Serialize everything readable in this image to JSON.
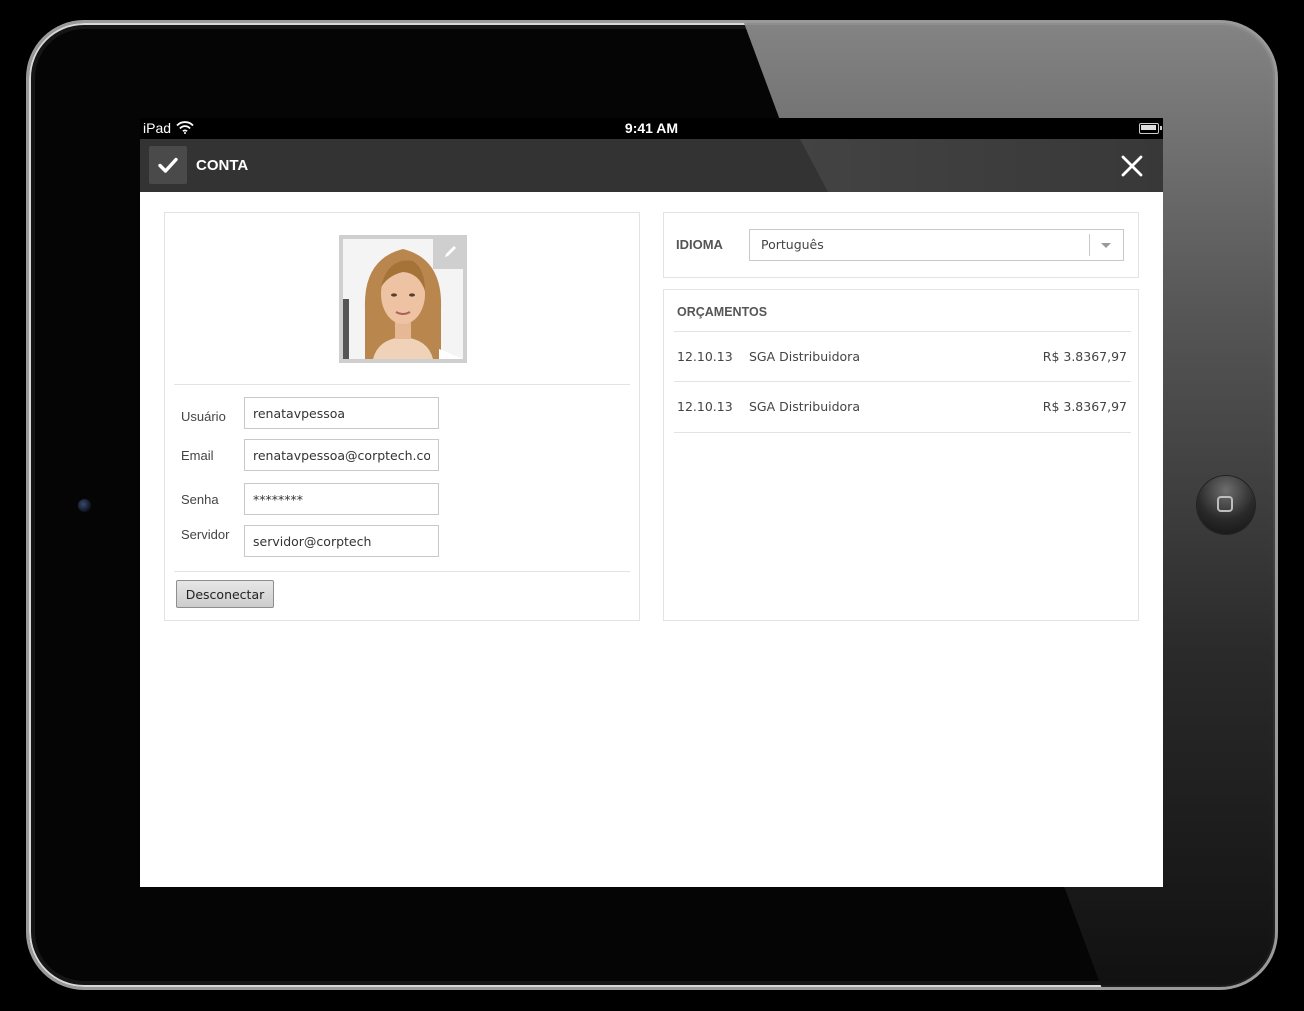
{
  "statusbar": {
    "carrier": "iPad",
    "time": "9:41 AM"
  },
  "navbar": {
    "title": "CONTA"
  },
  "profile": {
    "fields": [
      {
        "label": "Usuário",
        "value": "renatavpessoa"
      },
      {
        "label": "Email",
        "value": "renatavpessoa@corptech.com"
      },
      {
        "label": "Senha",
        "value": "********"
      },
      {
        "label": "Servidor",
        "value": "servidor@corptech"
      }
    ],
    "disconnect_label": "Desconectar"
  },
  "language": {
    "label": "IDIOMA",
    "selected": "Português"
  },
  "budgets": {
    "title": "ORÇAMENTOS",
    "rows": [
      {
        "date": "12.10.13",
        "name": "SGA Distribuidora",
        "amount": "R$ 3.8367,97"
      },
      {
        "date": "12.10.13",
        "name": "SGA Distribuidora",
        "amount": "R$ 3.8367,97"
      }
    ]
  },
  "colors": {
    "navbar": "#333333",
    "panel_border": "#e3e3e3",
    "device_bezel": "#050505"
  }
}
